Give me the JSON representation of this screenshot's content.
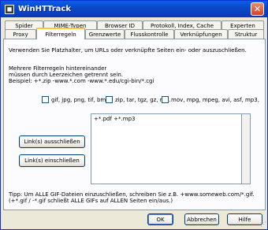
{
  "window": {
    "title": "WinHTTrack",
    "icon_glyph": "◼",
    "close_glyph": "✕"
  },
  "tabs": {
    "row1": [
      "Spider",
      "MIME-Typen",
      "Browser ID",
      "Protokoll, Index, Cache",
      "Experten"
    ],
    "row2": [
      "Proxy",
      "Filterregeln",
      "Grenzwerte",
      "Flusskontrolle",
      "Verknüpfungen",
      "Struktur"
    ],
    "active": "Filterregeln"
  },
  "panel": {
    "intro": "Verwenden Sie Platzhalter, um URLs oder verknüpfte Seiten ein- oder auszuschließen.",
    "multi_lines": [
      "Mehrere Filterregeln hintereinander",
      "müssen durch Leerzeichen getrennt sein.",
      "Beispiel: +*.zip -www.*.com -www.*.edu/cgi-bin/*.cgi"
    ],
    "checkboxes": [
      {
        "label": "gif, jpg, png, tif, bmp",
        "checked": false
      },
      {
        "label": "zip, tar, tgz, gz, rar..",
        "checked": false
      },
      {
        "label": "mov, mpg, mpeg, avi, asf, mp3,",
        "checked": false
      }
    ],
    "filter_text": "+*.pdf +*.mp3",
    "exclude_button": "Link(s) ausschließen",
    "include_button": "Link(s) einschließen",
    "tip_lines": [
      "Tipp: Um ALLE GIF-Dateien einzuschließen, schreiben Sie z.B. +www.someweb.com/*.gif.",
      "(+*.gif / -*.gif schließt ALLE GIFs auf ALLEN Seiten ein/aus.)"
    ]
  },
  "buttons": {
    "ok": "OK",
    "cancel": "Abbrechen",
    "help": "Hilfe"
  },
  "colors": {
    "titlebar": "#0a4fd6",
    "face": "#ece9d8",
    "active_tab_accent": "#ffc83c"
  }
}
